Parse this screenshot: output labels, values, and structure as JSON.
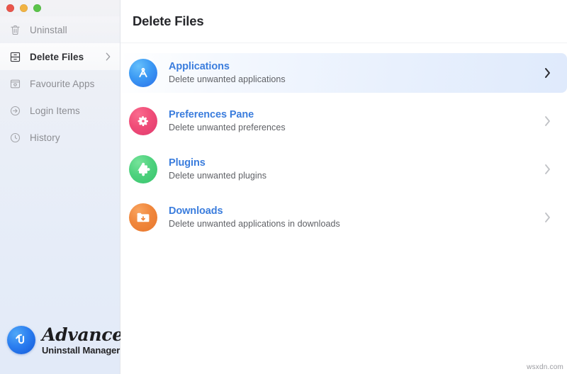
{
  "window": {
    "traffic_lights": [
      {
        "name": "close-button",
        "color": "#e9554b"
      },
      {
        "name": "minimize-button",
        "color": "#f1b342"
      },
      {
        "name": "maximize-button",
        "color": "#5bc44a"
      }
    ]
  },
  "sidebar": {
    "items": [
      {
        "label": "Uninstall",
        "icon": "trash-icon",
        "selected": false
      },
      {
        "label": "Delete Files",
        "icon": "drawers-icon",
        "selected": true,
        "chevron": "chevron-right-icon"
      },
      {
        "label": "Favourite Apps",
        "icon": "heart-card-icon",
        "selected": false
      },
      {
        "label": "Login Items",
        "icon": "arrow-in-circle-icon",
        "selected": false
      },
      {
        "label": "History",
        "icon": "clock-icon",
        "selected": false
      }
    ],
    "logo": {
      "icon": "app-logo-icon",
      "title": "Advanced",
      "subtitle": "Uninstall Manager"
    }
  },
  "main": {
    "title": "Delete Files",
    "rows": [
      {
        "title": "Applications",
        "subtitle": "Delete unwanted applications",
        "icon": "compass-app-icon",
        "icon_color": "#3c9af4",
        "selected": true,
        "chevron": "chevron-right-icon"
      },
      {
        "title": "Preferences Pane",
        "subtitle": "Delete unwanted preferences",
        "icon": "gear-icon",
        "icon_color": "#f04d78",
        "selected": false,
        "chevron": "chevron-right-icon"
      },
      {
        "title": "Plugins",
        "subtitle": "Delete unwanted plugins",
        "icon": "puzzle-piece-icon",
        "icon_color": "#4ed27e",
        "selected": false,
        "chevron": "chevron-right-icon"
      },
      {
        "title": "Downloads",
        "subtitle": "Delete unwanted applications in downloads",
        "icon": "folder-download-icon",
        "icon_color": "#f0873c",
        "selected": false,
        "chevron": "chevron-right-icon"
      }
    ]
  },
  "watermark": {
    "text": "wsxdn.com"
  },
  "colors": {
    "accent_blue": "#3b7ddd",
    "title_text": "#26272b",
    "subtitle_text": "#5f6166",
    "sidebar_inactive": "#8c8d92"
  }
}
